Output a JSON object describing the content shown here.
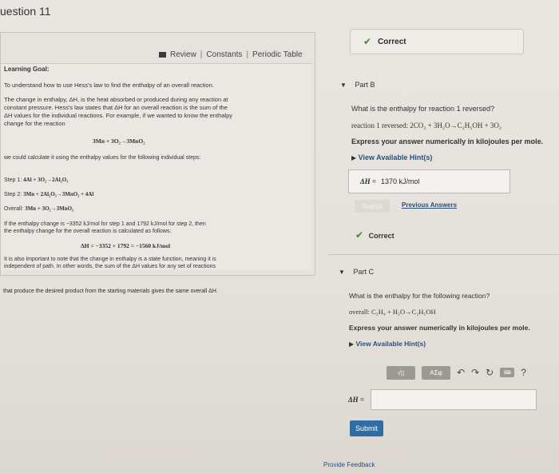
{
  "question_title": "uestion 11",
  "toolbar": {
    "review": "Review",
    "constants": "Constants",
    "periodic_table": "Periodic Table",
    "sep": "|"
  },
  "goal": {
    "heading": "Learning Goal:",
    "intro": "To understand how to use Hess's law to find the enthalpy of an overall reaction.",
    "p1": [
      "The change in enthalpy, ΔH, is the heat absorbed or produced during any reaction at",
      "constant pressure. Hess's law states that ΔH for an overall reaction is the sum of the",
      "ΔH values for the individual reactions. For example, if we wanted to know the enthalpy",
      "change for the reaction"
    ],
    "example_reaction": "3Mn + 3O₂→3MnO₂",
    "we_could": "we could calculate it using the enthalpy values for the following individual steps:",
    "step1_label": "Step 1:",
    "step1": "4Al + 3O₂→2Al₂O₃",
    "step2_label": "Step 2:",
    "step2": "3Mn + 2Al₂O₃→3MnO₂ + 4Al",
    "overall_label": "Overall:",
    "overall": "3Mn + 3O₂→3MnO₂",
    "if_line1": "If the enthalpy change is −3352 kJ/mol for step 1 and 1792 kJ/mol for step 2, then",
    "if_line2": "the enthalpy change for the overall reaction is calculated as follows:",
    "calc": "ΔH = −3352 + 1792 = −1560 kJ/mol",
    "state_fn": [
      "It is also important to note that the change in enthalpy is a state function, meaning it is",
      "independent of path. In other words, the sum of the ΔH values for any set of reactions",
      "that produce the desired product from the starting materials gives the same overall ΔH."
    ]
  },
  "correct_banner": "Correct",
  "part_b": {
    "label": "Part B",
    "question": "What is the enthalpy for reaction 1 reversed?",
    "reaction": "reaction 1 reversed: 2CO₂ + 3H₂O→C₂H₅OH + 3O₂",
    "express": "Express your answer numerically in kilojoules per mole.",
    "hints": "View Available Hint(s)",
    "answer_label": "ΔH =",
    "answer_value": "1370  kJ/mol",
    "submit": "Submit",
    "previous": "Previous Answers",
    "correct": "Correct"
  },
  "part_c": {
    "label": "Part C",
    "question": "What is the enthalpy for the following reaction?",
    "reaction": "overall: C₂H₄ + H₂O→C₂H₅OH",
    "express": "Express your answer numerically in kilojoules per mole.",
    "hints": "View Available Hint(s)",
    "toolbar_greek": "ΑΣφ",
    "toolbar_templates": "√▯",
    "answer_label": "ΔH =",
    "answer_value": "",
    "submit": "Submit",
    "help": "?"
  },
  "feedback": "Provide Feedback"
}
